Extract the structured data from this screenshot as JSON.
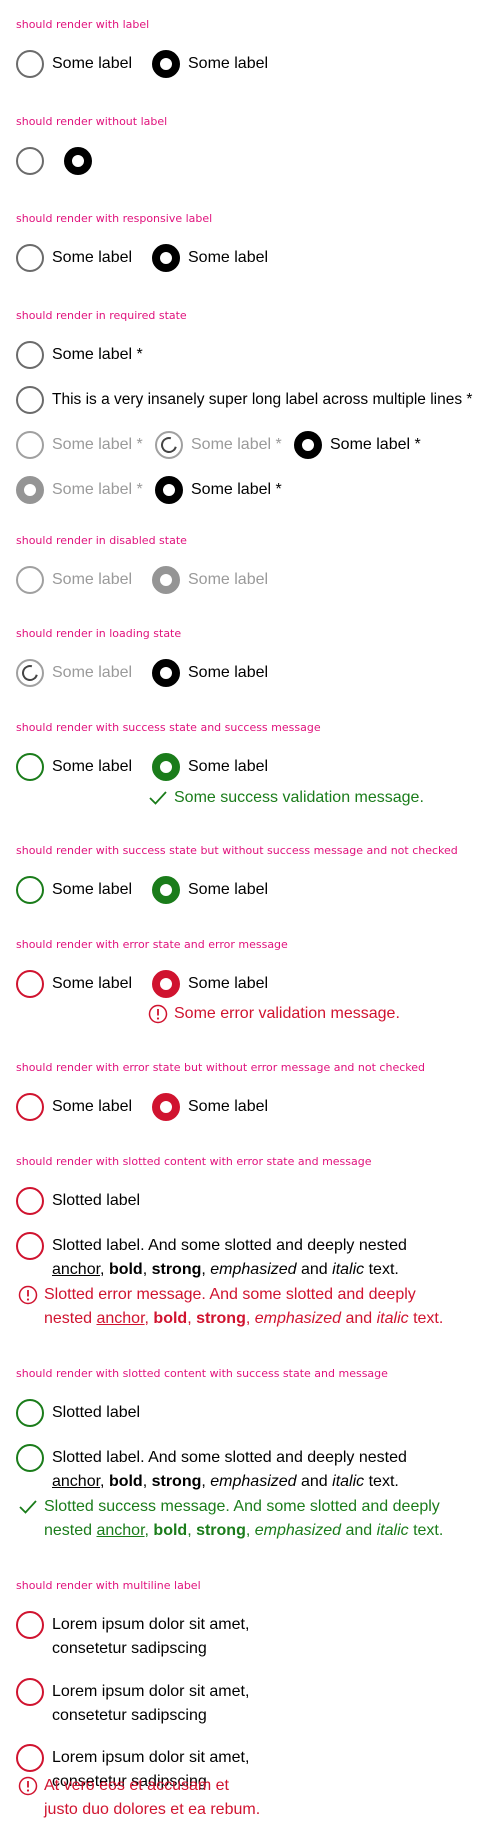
{
  "required_mark": " *",
  "sections": {
    "with_label": {
      "title": "should render with label",
      "label_a": "Some label",
      "label_b": "Some label"
    },
    "without_label": {
      "title": "should render without label"
    },
    "responsive": {
      "title": "should render with responsive label",
      "label_a": "Some label",
      "label_b": "Some label"
    },
    "required": {
      "title": "should render in required state",
      "label_1": "Some label *",
      "label_long": "This is a very insanely super long label across multiple lines *",
      "label_3a": "Some label *",
      "label_3b": "Some label *",
      "label_3c": "Some label *",
      "label_4a": "Some label *",
      "label_4b": "Some label *"
    },
    "disabled": {
      "title": "should render in disabled state",
      "label_a": "Some label",
      "label_b": "Some label"
    },
    "loading": {
      "title": "should render in loading state",
      "label_a": "Some label",
      "label_b": "Some label"
    },
    "success_msg": {
      "title": "should render with success state and success message",
      "label_a": "Some label",
      "label_b": "Some label",
      "message": "Some success validation message."
    },
    "success_nomsg": {
      "title": "should render with success state but without success message and not checked",
      "label_a": "Some label",
      "label_b": "Some label"
    },
    "error_msg": {
      "title": "should render with error state and error message",
      "label_a": "Some label",
      "label_b": "Some label",
      "message": "Some error validation message."
    },
    "error_nomsg": {
      "title": "should render with error state but without error message and not checked",
      "label_a": "Some label",
      "label_b": "Some label"
    },
    "slotted_error": {
      "title": "should render with slotted content with error state and message",
      "label_1": "Slotted label",
      "label_2": {
        "pre": "Slotted label. And some slotted and deeply nested ",
        "anchor": "anchor",
        "sep1": ", ",
        "bold": "bold",
        "sep2": ", ",
        "strong": "strong",
        "sep3": ", ",
        "emphasized": "emphasized",
        "and": " and ",
        "italic": "italic",
        "post": " text."
      },
      "message": {
        "pre": "Slotted error message. And some slotted and deeply nested ",
        "anchor": "anchor",
        "sep1": ", ",
        "bold": "bold",
        "sep2": ", ",
        "strong": "strong",
        "sep3": ", ",
        "emphasized": "emphasized",
        "and": " and ",
        "italic": "italic",
        "post": " text."
      }
    },
    "slotted_success": {
      "title": "should render with slotted content with success state and message",
      "label_1": "Slotted label",
      "label_2": {
        "pre": "Slotted label. And some slotted and deeply nested ",
        "anchor": "anchor",
        "sep1": ", ",
        "bold": "bold",
        "sep2": ", ",
        "strong": "strong",
        "sep3": ", ",
        "emphasized": "emphasized",
        "and": " and ",
        "italic": "italic",
        "post": " text."
      },
      "message": {
        "pre": "Slotted success message. And some slotted and deeply nested ",
        "anchor": "anchor",
        "sep1": ", ",
        "bold": "bold",
        "sep2": ", ",
        "strong": "strong",
        "sep3": ", ",
        "emphasized": "emphasized",
        "and": " and ",
        "italic": "italic",
        "post": " text."
      }
    },
    "multiline": {
      "title": "should render with multiline label",
      "label_1": "Lorem ipsum dolor sit amet, consetetur sadipscing",
      "label_2": "Lorem ipsum dolor sit amet, consetetur sadipscing",
      "label_3": "Lorem ipsum dolor sit amet, consetetur sadipscing",
      "message": "At vero eos et accusam et justo duo dolores et ea rebum."
    }
  },
  "colors": {
    "title": "#e0127c",
    "success": "#1a7c1a",
    "error": "#d0132f",
    "disabled": "#959595"
  },
  "icons": {
    "success": "check-icon",
    "error": "exclamation-circle-icon",
    "loading": "spinner-icon"
  }
}
